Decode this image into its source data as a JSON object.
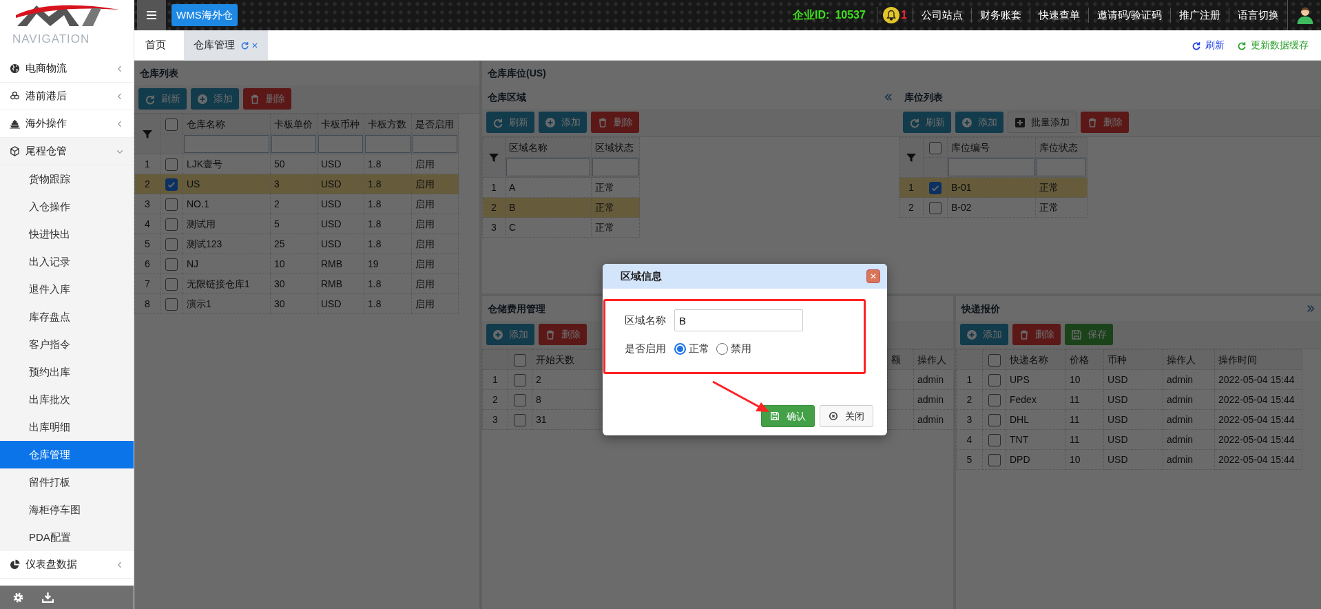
{
  "header": {
    "app_badge": "WMS海外仓",
    "company_label": "企业ID:",
    "company_id": "10537",
    "notification_count": "1",
    "links": [
      "公司站点",
      "财务账套",
      "快速查单",
      "邀请码/验证码",
      "推广注册",
      "语言切换"
    ]
  },
  "sidebar": {
    "heading": "NAVIGATION",
    "items": [
      {
        "label": "电商物流",
        "expanded": false
      },
      {
        "label": "港前港后",
        "expanded": false
      },
      {
        "label": "海外操作",
        "expanded": false
      },
      {
        "label": "尾程仓管",
        "expanded": true,
        "children": [
          {
            "label": "货物跟踪",
            "selected": false
          },
          {
            "label": "入仓操作",
            "selected": false
          },
          {
            "label": "快进快出",
            "selected": false
          },
          {
            "label": "出入记录",
            "selected": false
          },
          {
            "label": "退件入库",
            "selected": false
          },
          {
            "label": "库存盘点",
            "selected": false
          },
          {
            "label": "客户指令",
            "selected": false
          },
          {
            "label": "预约出库",
            "selected": false
          },
          {
            "label": "出库批次",
            "selected": false
          },
          {
            "label": "出库明细",
            "selected": false
          },
          {
            "label": "仓库管理",
            "selected": true
          },
          {
            "label": "留件打板",
            "selected": false
          },
          {
            "label": "海柜停车图",
            "selected": false
          },
          {
            "label": "PDA配置",
            "selected": false
          }
        ]
      },
      {
        "label": "仪表盘数据",
        "expanded": false
      }
    ]
  },
  "tabs": [
    {
      "label": "首页",
      "selected": false,
      "closable": false
    },
    {
      "label": "仓库管理",
      "selected": true,
      "closable": true
    }
  ],
  "tab_actions": [
    "刷新",
    "更新数据缓存"
  ],
  "warehouse_list": {
    "title": "仓库列表",
    "buttons": [
      {
        "label": "刷新",
        "kind": "refresh"
      },
      {
        "label": "添加",
        "kind": "add"
      },
      {
        "label": "删除",
        "kind": "delete"
      }
    ],
    "all_checked": false,
    "columns": [
      "仓库名称",
      "卡板单价",
      "卡板币种",
      "卡板方数",
      "是否启用"
    ],
    "rows": [
      {
        "index": "1",
        "checked": false,
        "selected": false,
        "cells": [
          "LJK壹号",
          "50",
          "USD",
          "1.8",
          "启用"
        ]
      },
      {
        "index": "2",
        "checked": true,
        "selected": true,
        "cells": [
          "US",
          "3",
          "USD",
          "1.8",
          "启用"
        ]
      },
      {
        "index": "3",
        "checked": false,
        "selected": false,
        "cells": [
          "NO.1",
          "2",
          "USD",
          "1.8",
          "启用"
        ]
      },
      {
        "index": "4",
        "checked": false,
        "selected": false,
        "cells": [
          "测试用",
          "5",
          "USD",
          "1.8",
          "启用"
        ]
      },
      {
        "index": "5",
        "checked": false,
        "selected": false,
        "cells": [
          "测试123",
          "25",
          "USD",
          "1.8",
          "启用"
        ]
      },
      {
        "index": "6",
        "checked": false,
        "selected": false,
        "cells": [
          "NJ",
          "10",
          "RMB",
          "19",
          "启用"
        ]
      },
      {
        "index": "7",
        "checked": false,
        "selected": false,
        "cells": [
          "无限链接仓库1",
          "30",
          "RMB",
          "1.8",
          "启用"
        ]
      },
      {
        "index": "8",
        "checked": false,
        "selected": false,
        "cells": [
          "演示1",
          "30",
          "USD",
          "1.8",
          "启用"
        ]
      }
    ]
  },
  "locations": {
    "title": "仓库库位(US)",
    "zones": {
      "title": "仓库区域",
      "buttons": [
        {
          "label": "刷新",
          "kind": "refresh"
        },
        {
          "label": "添加",
          "kind": "add"
        },
        {
          "label": "删除",
          "kind": "delete"
        }
      ],
      "columns": [
        "区域名称",
        "区域状态"
      ],
      "rows": [
        {
          "index": "1",
          "selected": false,
          "cells": [
            "A",
            "正常"
          ]
        },
        {
          "index": "2",
          "selected": true,
          "cells": [
            "B",
            "正常"
          ]
        },
        {
          "index": "3",
          "selected": false,
          "cells": [
            "C",
            "正常"
          ]
        }
      ]
    },
    "slots": {
      "title": "库位列表",
      "buttons": [
        {
          "label": "刷新",
          "kind": "refresh"
        },
        {
          "label": "添加",
          "kind": "add"
        },
        {
          "label": "批量添加",
          "kind": "batch"
        },
        {
          "label": "删除",
          "kind": "delete"
        }
      ],
      "all_checked": false,
      "columns": [
        "库位编号",
        "库位状态"
      ],
      "rows": [
        {
          "index": "1",
          "checked": true,
          "selected": true,
          "cells": [
            "B-01",
            "正常"
          ]
        },
        {
          "index": "2",
          "checked": false,
          "selected": false,
          "cells": [
            "B-02",
            "正常"
          ]
        }
      ]
    }
  },
  "storage_fees": {
    "title": "仓储费用管理",
    "buttons": [
      {
        "label": "添加",
        "kind": "add"
      },
      {
        "label": "删除",
        "kind": "delete"
      }
    ],
    "all_checked": false,
    "columns": [
      "开始天数",
      "额",
      "操作人"
    ],
    "rows": [
      {
        "index": "1",
        "checked": false,
        "cells": [
          "2",
          null,
          "admin"
        ]
      },
      {
        "index": "2",
        "checked": false,
        "cells": [
          "8",
          null,
          "admin"
        ]
      },
      {
        "index": "3",
        "checked": false,
        "cells": [
          "31",
          null,
          "admin"
        ]
      }
    ]
  },
  "express_quotes": {
    "title": "快递报价",
    "buttons": [
      {
        "label": "添加",
        "kind": "add"
      },
      {
        "label": "删除",
        "kind": "delete"
      },
      {
        "label": "保存",
        "kind": "save"
      }
    ],
    "all_checked": false,
    "columns": [
      "快递名称",
      "价格",
      "币种",
      "操作人",
      "操作时间"
    ],
    "rows": [
      {
        "index": "1",
        "checked": false,
        "cells": [
          "UPS",
          "10",
          "USD",
          "admin",
          "2022-05-04 15:44"
        ]
      },
      {
        "index": "2",
        "checked": false,
        "cells": [
          "Fedex",
          "11",
          "USD",
          "admin",
          "2022-05-04 15:44"
        ]
      },
      {
        "index": "3",
        "checked": false,
        "cells": [
          "DHL",
          "11",
          "USD",
          "admin",
          "2022-05-04 15:44"
        ]
      },
      {
        "index": "4",
        "checked": false,
        "cells": [
          "TNT",
          "11",
          "USD",
          "admin",
          "2022-05-04 15:44"
        ]
      },
      {
        "index": "5",
        "checked": false,
        "cells": [
          "DPD",
          "10",
          "USD",
          "admin",
          "2022-05-04 15:44"
        ]
      }
    ]
  },
  "dialog": {
    "title": "区域信息",
    "fields": [
      {
        "kind": "text",
        "label": "区域名称",
        "value": "B"
      },
      {
        "kind": "radio",
        "label": "是否启用",
        "options": [
          {
            "label": "正常",
            "selected": true
          },
          {
            "label": "禁用",
            "selected": false
          }
        ]
      }
    ],
    "buttons": [
      {
        "label": "确认",
        "kind": "confirm"
      },
      {
        "label": "关闭",
        "kind": "close"
      }
    ]
  }
}
